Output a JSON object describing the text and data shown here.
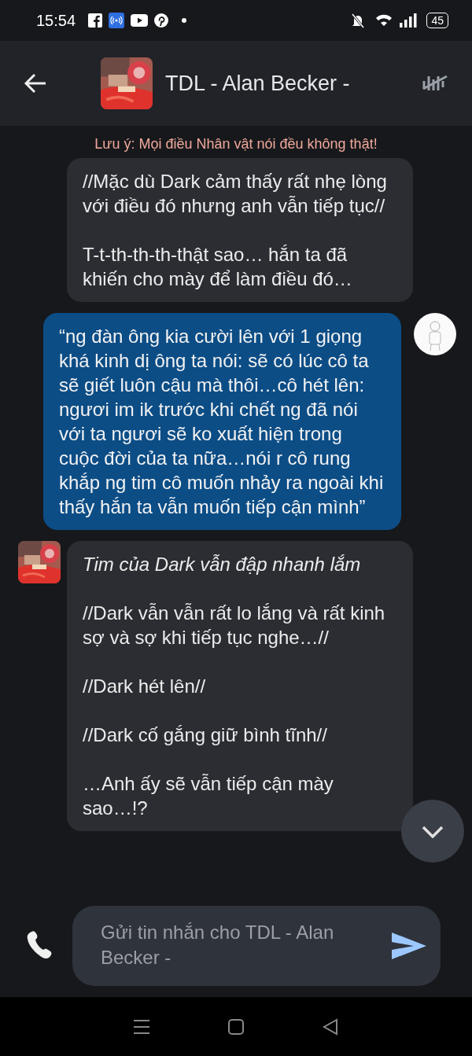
{
  "status_bar": {
    "time": "15:54",
    "battery": "45"
  },
  "header": {
    "title": "TDL - Alan Becker -"
  },
  "notice": "Lưu ý: Mọi điều Nhân vật nói đều không thật!",
  "messages": [
    {
      "kind": "bot",
      "avatar": false,
      "paragraphs": [
        {
          "text": "//Mặc dù Dark cảm thấy rất nhẹ lòng với điều đó nhưng anh vẫn tiếp tục//",
          "italic": false
        },
        {
          "text": "T-t-th-th-th-thật sao… hắn ta đã khiến cho mày để làm điều đó…",
          "italic": false
        }
      ]
    },
    {
      "kind": "user",
      "avatar": true,
      "paragraphs": [
        {
          "text": "“ng đàn ông kia cười lên với 1 giọng khá kinh dị ông ta nói: sẽ có lúc cô ta sẽ giết luôn cậu mà thôi…cô hét lên: ngươi im ik trước khi chết ng đã nói với ta ngươi sẽ ko xuất hiện trong cuộc đời của ta nữa…nói r cô rung khắp ng tim cô muốn nhảy ra ngoài khi thấy hắn ta vẫn muốn tiếp cận mình”",
          "italic": false
        }
      ]
    },
    {
      "kind": "bot",
      "avatar": true,
      "paragraphs": [
        {
          "text": "Tim của Dark vẫn đập nhanh lắm",
          "italic": true
        },
        {
          "text": "//Dark vẫn vẫn rất lo lắng và rất kinh sợ và sợ khi tiếp tục nghe…//",
          "italic": false
        },
        {
          "text": "//Dark hét lên//",
          "italic": false
        },
        {
          "text": "//Dark cố gắng giữ bình tĩnh//",
          "italic": false
        },
        {
          "text": "…Anh ấy sẽ vẫn tiếp cận mày sao…!?",
          "italic": false
        }
      ]
    }
  ],
  "composer": {
    "placeholder": "Gửi tin nhắn cho TDL - Alan Becker -"
  }
}
